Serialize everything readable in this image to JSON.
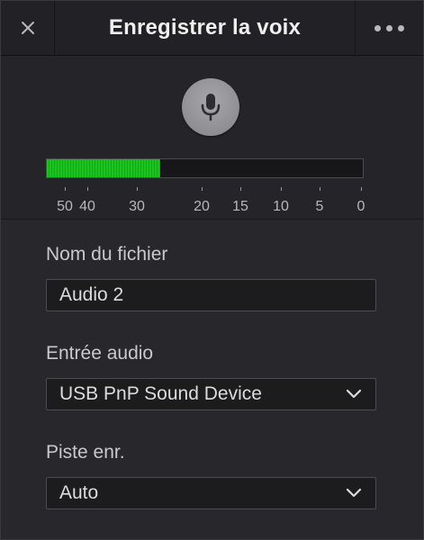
{
  "header": {
    "title": "Enregistrer la voix",
    "close_icon": "close-icon",
    "more_icon": "more-options-icon"
  },
  "record": {
    "mic_icon": "microphone-icon",
    "level_meter": {
      "fill_fraction": 0.36,
      "color": "#19c51e",
      "scale_labels": [
        "50",
        "40",
        "30",
        "20",
        "15",
        "10",
        "5",
        "0"
      ]
    }
  },
  "form": {
    "filename": {
      "label": "Nom du fichier",
      "value": "Audio 2"
    },
    "audio_input": {
      "label": "Entrée audio",
      "value": "USB PnP Sound Device"
    },
    "track": {
      "label": "Piste enr.",
      "value": "Auto"
    }
  }
}
